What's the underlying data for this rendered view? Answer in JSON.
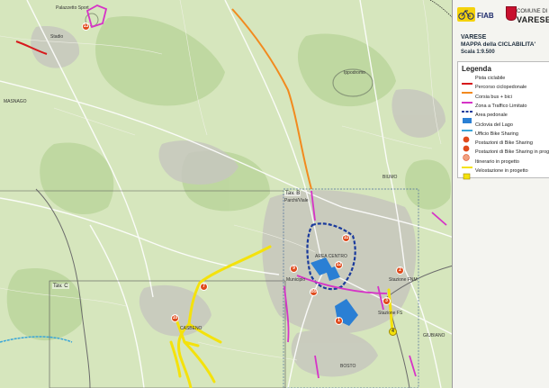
{
  "map": {
    "header": {
      "fiab_label": "FIAB",
      "comune_line1": "COMUNE DI",
      "comune_line2": "VARESE"
    },
    "title": {
      "line1": "VARESE",
      "line2": "MAPPA della CICLABILITA'",
      "line3": "Scala 1:9.500"
    },
    "legend": {
      "title": "Legenda",
      "items": [
        {
          "label": "Pista ciclabile",
          "symbol": "line",
          "color": "#d7191c"
        },
        {
          "label": "Percorso ciclopedonale",
          "symbol": "line",
          "color": "#f28a1e"
        },
        {
          "label": "Corsia bus + bici",
          "symbol": "line",
          "color": "#d633c7"
        },
        {
          "label": "Zona a Traffico Limitato",
          "symbol": "dash",
          "color": "#1a3a9c"
        },
        {
          "label": "Area pedonale",
          "symbol": "fill",
          "color": "#2a7fd4"
        },
        {
          "label": "Ciclovia del Lago",
          "symbol": "line",
          "color": "#3aa6d8"
        },
        {
          "label": "Ufficio Bike Sharing",
          "symbol": "pin",
          "color": "#e04a1c"
        },
        {
          "label": "Postazioni di Bike Sharing",
          "symbol": "pin",
          "color": "#e04a1c"
        },
        {
          "label": "Postazioni di Bike Sharing in progetto",
          "symbol": "pin-light",
          "color": "#f0a080"
        },
        {
          "label": "Itinerario in progetto",
          "symbol": "line",
          "color": "#f4e20c"
        },
        {
          "label": "Velostazione in progetto",
          "symbol": "pin-yellow",
          "color": "#f4e20c"
        }
      ]
    },
    "place_labels": {
      "palazzetto": "Palazzetto Sport",
      "stadio": "Stadio",
      "ippodromo": "Ippodromo",
      "masnago": "MASNAGO",
      "biumo": "BIUMO",
      "tav_b": "Tav. B",
      "tav_b_sub": "Parchi/Viale",
      "tav_c": "Tav. C",
      "casbeno": "CASBENO",
      "giubiano": "GIUBIANO",
      "bosto": "BOSTO",
      "municipio": "Municipio",
      "stazione_fnm": "Stazione FNM",
      "stazione_fs": "Stazione FS",
      "area_zentro": "AREA CENTRO"
    },
    "pins": [
      {
        "num": "13"
      },
      {
        "num": "11"
      },
      {
        "num": "12"
      },
      {
        "num": "9"
      },
      {
        "num": "B5"
      },
      {
        "num": "2"
      },
      {
        "num": "3"
      },
      {
        "num": "6"
      },
      {
        "num": "7"
      },
      {
        "num": "10"
      },
      {
        "num": "1"
      },
      {
        "num": "4"
      }
    ],
    "colors": {
      "background": "#d8e6c0",
      "urban": "#c9c9c2",
      "cycle_track": "#d7191c",
      "cycle_ped": "#f28a1e",
      "bus_bike": "#d633c7",
      "ztl": "#1a3a9c",
      "pedestrian": "#2a7fd4",
      "project": "#f4e20c"
    }
  }
}
